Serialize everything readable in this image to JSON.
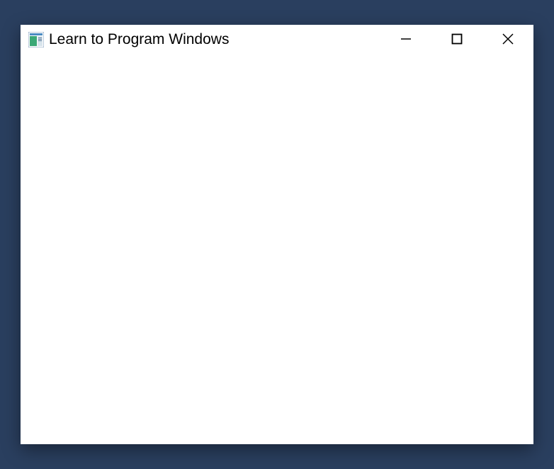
{
  "window": {
    "title": "Learn to Program Windows"
  }
}
